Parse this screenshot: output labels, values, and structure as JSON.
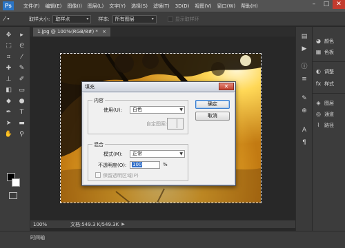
{
  "app": {
    "logo": "Ps"
  },
  "menu": [
    "文件(F)",
    "编辑(E)",
    "图像(I)",
    "图层(L)",
    "文字(Y)",
    "选择(S)",
    "滤镜(T)",
    "3D(D)",
    "视图(V)",
    "窗口(W)",
    "帮助(H)"
  ],
  "window_controls": {
    "minimize": "–",
    "maximize": "□",
    "close": "✕"
  },
  "options": {
    "sample_size_label": "取样大小:",
    "sample_size_value": "取样点",
    "sample_label": "样本:",
    "sample_value": "所有图层",
    "show_ring_label": "显示取样环"
  },
  "tools": [
    {
      "icon": "move-icon",
      "glyph": "✥"
    },
    {
      "icon": "artboard-icon",
      "glyph": "▸"
    },
    {
      "icon": "marquee-icon",
      "glyph": "⬚"
    },
    {
      "icon": "lasso-icon",
      "glyph": "ᘓ"
    },
    {
      "icon": "crop-icon",
      "glyph": "⌗"
    },
    {
      "icon": "eyedropper-icon",
      "glyph": "⁄"
    },
    {
      "icon": "healing-icon",
      "glyph": "✚"
    },
    {
      "icon": "brush-icon",
      "glyph": "✎"
    },
    {
      "icon": "stamp-icon",
      "glyph": "⊥"
    },
    {
      "icon": "history-brush-icon",
      "glyph": "✐"
    },
    {
      "icon": "eraser-icon",
      "glyph": "◧"
    },
    {
      "icon": "gradient-icon",
      "glyph": "▭"
    },
    {
      "icon": "blur-icon",
      "glyph": "◆"
    },
    {
      "icon": "dodge-icon",
      "glyph": "●"
    },
    {
      "icon": "pen-icon",
      "glyph": "✒"
    },
    {
      "icon": "type-icon",
      "glyph": "T"
    },
    {
      "icon": "path-select-icon",
      "glyph": "➤"
    },
    {
      "icon": "shape-icon",
      "glyph": "▬"
    },
    {
      "icon": "hand-icon",
      "glyph": "✋"
    },
    {
      "icon": "zoom-icon",
      "glyph": "⚲"
    }
  ],
  "document": {
    "tab_title": "1.jpg @ 100%(RGB/8#) *",
    "tab_close": "×",
    "zoom": "100%",
    "doc_info": "文档:549.3 K/549.3K"
  },
  "timeline_label": "时间轴",
  "right_panel": {
    "items": [
      {
        "icon": "palette-icon",
        "glyph": "◕",
        "label": "颜色"
      },
      {
        "icon": "swatches-icon",
        "glyph": "▦",
        "label": "色板"
      },
      {
        "icon": "adjustments-icon",
        "glyph": "◐",
        "label": "调整"
      },
      {
        "icon": "styles-icon",
        "glyph": "fx",
        "label": "样式"
      },
      {
        "icon": "layers-icon",
        "glyph": "◈",
        "label": "图层"
      },
      {
        "icon": "channels-icon",
        "glyph": "◎",
        "label": "通道"
      },
      {
        "icon": "paths-icon",
        "glyph": "⌇",
        "label": "路径"
      }
    ]
  },
  "dialog": {
    "title": "填充",
    "close": "✕",
    "content_group": "内容",
    "use_label": "使用(U):",
    "use_value": "白色",
    "custom_pattern_label": "自定图案:",
    "blend_group": "混合",
    "mode_label": "模式(M):",
    "mode_value": "正常",
    "opacity_label": "不透明度(O):",
    "opacity_value": "100",
    "opacity_unit": "%",
    "preserve_label": "保留透明区域(P)",
    "ok_label": "确定",
    "cancel_label": "取消"
  }
}
